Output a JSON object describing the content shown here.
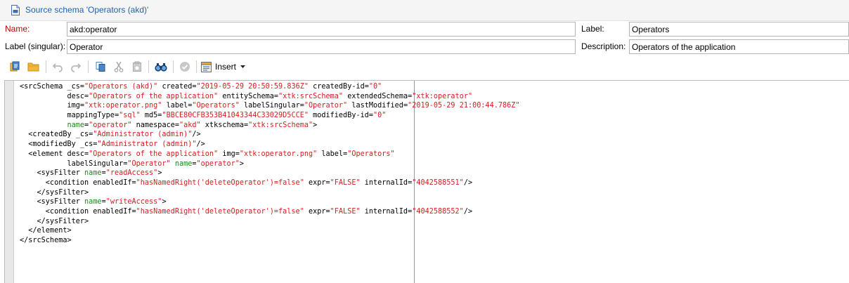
{
  "window": {
    "title": "Source schema 'Operators (akd)'"
  },
  "form": {
    "name_label": "Name:",
    "name_value": "akd:operator",
    "label_label": "Label:",
    "label_value": "Operators",
    "singular_label": "Label (singular):",
    "singular_value": "Operator",
    "description_label": "Description:",
    "description_value": "Operators of the application"
  },
  "toolbar": {
    "insert_label": "Insert",
    "icons": [
      "new-source-icon",
      "open-folder-icon",
      "undo-icon",
      "redo-icon",
      "copy-icon",
      "cut-icon",
      "paste-icon",
      "find-icon",
      "validate-icon",
      "insert-icon",
      "dropdown-arrow-icon"
    ]
  },
  "editor": {
    "lines": [
      "<srcSchema _cs=\"Operators (akd)\" created=\"2019-05-29 20:50:59.836Z\" createdBy-id=\"0\"",
      "           desc=\"Operators of the application\" entitySchema=\"xtk:srcSchema\" extendedSchema=\"xtk:operator\"",
      "           img=\"xtk:operator.png\" label=\"Operators\" labelSingular=\"Operator\" lastModified=\"2019-05-29 21:00:44.786Z\"",
      "           mappingType=\"sql\" md5=\"BBCE80CFB353B41043344C33029D5CCE\" modifiedBy-id=\"0\"",
      "           name=\"operator\" namespace=\"akd\" xtkschema=\"xtk:srcSchema\">",
      "  <createdBy _cs=\"Administrator (admin)\"/>",
      "  <modifiedBy _cs=\"Administrator (admin)\"/>",
      "  <element desc=\"Operators of the application\" img=\"xtk:operator.png\" label=\"Operators\"",
      "           labelSingular=\"Operator\" name=\"operator\">",
      "    <sysFilter name=\"readAccess\">",
      "      <condition enabledIf=\"hasNamedRight('deleteOperator')=false\" expr=\"FALSE\" internalId=\"4042588551\"/>",
      "    </sysFilter>",
      "    <sysFilter name=\"writeAccess\">",
      "      <condition enabledIf=\"hasNamedRight('deleteOperator')=false\" expr=\"FALSE\" internalId=\"4042588552\"/>",
      "    </sysFilter>",
      "  </element>",
      "</srcSchema>"
    ]
  },
  "colors": {
    "title_text": "#1e62b0",
    "required_label": "#c00000",
    "attr_value": "#d42020",
    "name_attr": "#1d8a1d"
  }
}
